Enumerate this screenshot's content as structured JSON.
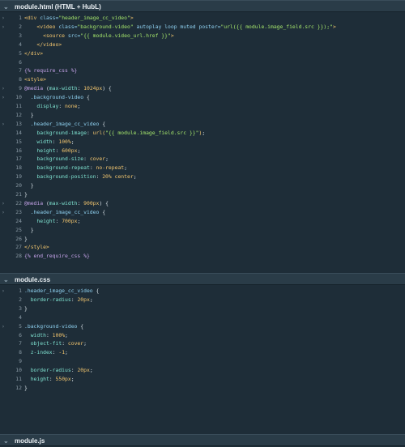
{
  "panels": {
    "html": {
      "title": "module.html (HTML + HubL)",
      "lines": [
        {
          "n": "1",
          "segs": [
            [
              "tag",
              "<div "
            ],
            [
              "attr",
              "class="
            ],
            [
              "str",
              "\"header_image_cc_video\""
            ],
            [
              "tag",
              ">"
            ]
          ]
        },
        {
          "n": "2",
          "segs": [
            [
              "plain",
              "    "
            ],
            [
              "tag",
              "<video "
            ],
            [
              "attr",
              "class="
            ],
            [
              "str",
              "\"background-video\""
            ],
            [
              "attr",
              " autoplay loop muted poster="
            ],
            [
              "str",
              "\"url({{ module.image_field.src }});\""
            ],
            [
              "tag",
              ">"
            ]
          ]
        },
        {
          "n": "3",
          "segs": [
            [
              "plain",
              "      "
            ],
            [
              "tag",
              "<source "
            ],
            [
              "attr",
              "src="
            ],
            [
              "str",
              "\"{{ module.video_url.href }}\""
            ],
            [
              "tag",
              ">"
            ]
          ]
        },
        {
          "n": "4",
          "segs": [
            [
              "plain",
              "    "
            ],
            [
              "tag",
              "</video>"
            ]
          ]
        },
        {
          "n": "5",
          "segs": [
            [
              "tag",
              "</div>"
            ]
          ]
        },
        {
          "n": "6",
          "segs": []
        },
        {
          "n": "7",
          "segs": [
            [
              "kw",
              "{% require_css %}"
            ]
          ]
        },
        {
          "n": "8",
          "segs": [
            [
              "tag",
              "<style>"
            ]
          ]
        },
        {
          "n": "9",
          "segs": [
            [
              "kw",
              "@media "
            ],
            [
              "punc",
              "("
            ],
            [
              "prop",
              "max-width"
            ],
            [
              "punc",
              ": "
            ],
            [
              "val",
              "1024px"
            ],
            [
              "punc",
              ") {"
            ]
          ]
        },
        {
          "n": "10",
          "segs": [
            [
              "plain",
              "  "
            ],
            [
              "attr",
              ".background-video"
            ],
            [
              "punc",
              " {"
            ]
          ]
        },
        {
          "n": "11",
          "segs": [
            [
              "plain",
              "    "
            ],
            [
              "prop",
              "display"
            ],
            [
              "punc",
              ": "
            ],
            [
              "val",
              "none"
            ],
            [
              "punc",
              ";"
            ]
          ]
        },
        {
          "n": "12",
          "segs": [
            [
              "plain",
              "  "
            ],
            [
              "punc",
              "}"
            ]
          ]
        },
        {
          "n": "13",
          "segs": [
            [
              "plain",
              "  "
            ],
            [
              "attr",
              ".header_image_cc_video"
            ],
            [
              "punc",
              " {"
            ]
          ]
        },
        {
          "n": "14",
          "segs": [
            [
              "plain",
              "    "
            ],
            [
              "prop",
              "background-image"
            ],
            [
              "punc",
              ": "
            ],
            [
              "val",
              "url("
            ],
            [
              "str",
              "\"{{ module.image_field.src }}\""
            ],
            [
              "val",
              ")"
            ],
            [
              "punc",
              ";"
            ]
          ]
        },
        {
          "n": "15",
          "segs": [
            [
              "plain",
              "    "
            ],
            [
              "prop",
              "width"
            ],
            [
              "punc",
              ": "
            ],
            [
              "val",
              "100%"
            ],
            [
              "punc",
              ";"
            ]
          ]
        },
        {
          "n": "16",
          "segs": [
            [
              "plain",
              "    "
            ],
            [
              "prop",
              "height"
            ],
            [
              "punc",
              ": "
            ],
            [
              "val",
              "600px"
            ],
            [
              "punc",
              ";"
            ]
          ]
        },
        {
          "n": "17",
          "segs": [
            [
              "plain",
              "    "
            ],
            [
              "prop",
              "background-size"
            ],
            [
              "punc",
              ": "
            ],
            [
              "val",
              "cover"
            ],
            [
              "punc",
              ";"
            ]
          ]
        },
        {
          "n": "18",
          "segs": [
            [
              "plain",
              "    "
            ],
            [
              "prop",
              "background-repeat"
            ],
            [
              "punc",
              ": "
            ],
            [
              "val",
              "no-repeat"
            ],
            [
              "punc",
              ";"
            ]
          ]
        },
        {
          "n": "19",
          "segs": [
            [
              "plain",
              "    "
            ],
            [
              "prop",
              "background-position"
            ],
            [
              "punc",
              ": "
            ],
            [
              "val",
              "20% center"
            ],
            [
              "punc",
              ";"
            ]
          ]
        },
        {
          "n": "20",
          "segs": [
            [
              "plain",
              "  "
            ],
            [
              "punc",
              "}"
            ]
          ]
        },
        {
          "n": "21",
          "segs": [
            [
              "punc",
              "}"
            ]
          ]
        },
        {
          "n": "22",
          "segs": [
            [
              "kw",
              "@media "
            ],
            [
              "punc",
              "("
            ],
            [
              "prop",
              "max-width"
            ],
            [
              "punc",
              ": "
            ],
            [
              "val",
              "900px"
            ],
            [
              "punc",
              ") {"
            ]
          ]
        },
        {
          "n": "23",
          "segs": [
            [
              "plain",
              "  "
            ],
            [
              "attr",
              ".header_image_cc_video"
            ],
            [
              "punc",
              " {"
            ]
          ]
        },
        {
          "n": "24",
          "segs": [
            [
              "plain",
              "    "
            ],
            [
              "prop",
              "height"
            ],
            [
              "punc",
              ": "
            ],
            [
              "val",
              "700px"
            ],
            [
              "punc",
              ";"
            ]
          ]
        },
        {
          "n": "25",
          "segs": [
            [
              "plain",
              "  "
            ],
            [
              "punc",
              "}"
            ]
          ]
        },
        {
          "n": "26",
          "segs": [
            [
              "punc",
              "}"
            ]
          ]
        },
        {
          "n": "27",
          "segs": [
            [
              "tag",
              "</style>"
            ]
          ]
        },
        {
          "n": "28",
          "segs": [
            [
              "kw",
              "{% end_require_css %}"
            ]
          ]
        }
      ]
    },
    "css": {
      "title": "module.css",
      "lines": [
        {
          "n": "1",
          "segs": [
            [
              "attr",
              ".header_image_cc_video"
            ],
            [
              "punc",
              " {"
            ]
          ]
        },
        {
          "n": "2",
          "segs": [
            [
              "plain",
              "  "
            ],
            [
              "prop",
              "border-radius"
            ],
            [
              "punc",
              ": "
            ],
            [
              "val",
              "20px"
            ],
            [
              "punc",
              ";"
            ]
          ]
        },
        {
          "n": "3",
          "segs": [
            [
              "punc",
              "}"
            ]
          ]
        },
        {
          "n": "4",
          "segs": []
        },
        {
          "n": "5",
          "segs": [
            [
              "attr",
              ".background-video"
            ],
            [
              "punc",
              " {"
            ]
          ]
        },
        {
          "n": "6",
          "segs": [
            [
              "plain",
              "  "
            ],
            [
              "prop",
              "width"
            ],
            [
              "punc",
              ": "
            ],
            [
              "val",
              "100%"
            ],
            [
              "punc",
              ";"
            ]
          ]
        },
        {
          "n": "7",
          "segs": [
            [
              "plain",
              "  "
            ],
            [
              "prop",
              "object-fit"
            ],
            [
              "punc",
              ": "
            ],
            [
              "val",
              "cover"
            ],
            [
              "punc",
              ";"
            ]
          ]
        },
        {
          "n": "8",
          "segs": [
            [
              "plain",
              "  "
            ],
            [
              "prop",
              "z-index"
            ],
            [
              "punc",
              ": "
            ],
            [
              "val",
              "-1"
            ],
            [
              "punc",
              ";"
            ]
          ]
        },
        {
          "n": "9",
          "segs": []
        },
        {
          "n": "10",
          "segs": [
            [
              "plain",
              "  "
            ],
            [
              "prop",
              "border-radius"
            ],
            [
              "punc",
              ": "
            ],
            [
              "val",
              "20px"
            ],
            [
              "punc",
              ";"
            ]
          ]
        },
        {
          "n": "11",
          "segs": [
            [
              "plain",
              "  "
            ],
            [
              "prop",
              "height"
            ],
            [
              "punc",
              ": "
            ],
            [
              "val",
              "550px"
            ],
            [
              "punc",
              ";"
            ]
          ]
        },
        {
          "n": "12",
          "segs": [
            [
              "punc",
              "}"
            ]
          ]
        }
      ]
    },
    "js": {
      "title": "module.js",
      "lines": []
    }
  },
  "fold_lines": {
    "html": [
      "1",
      "2",
      "9",
      "10",
      "13",
      "22",
      "23"
    ],
    "css": [
      "1",
      "5"
    ]
  },
  "icons": {
    "panel_toggle": "chevron-down-icon",
    "fold_marker": "fold-arrow-icon"
  },
  "colors": {
    "background": "#1e2d38",
    "header": "#2a3c48",
    "tag": "#f2c56e",
    "attribute": "#8fd1f0",
    "string": "#a3e36b",
    "keyword": "#c4a2e8",
    "property": "#7fe3d1"
  }
}
